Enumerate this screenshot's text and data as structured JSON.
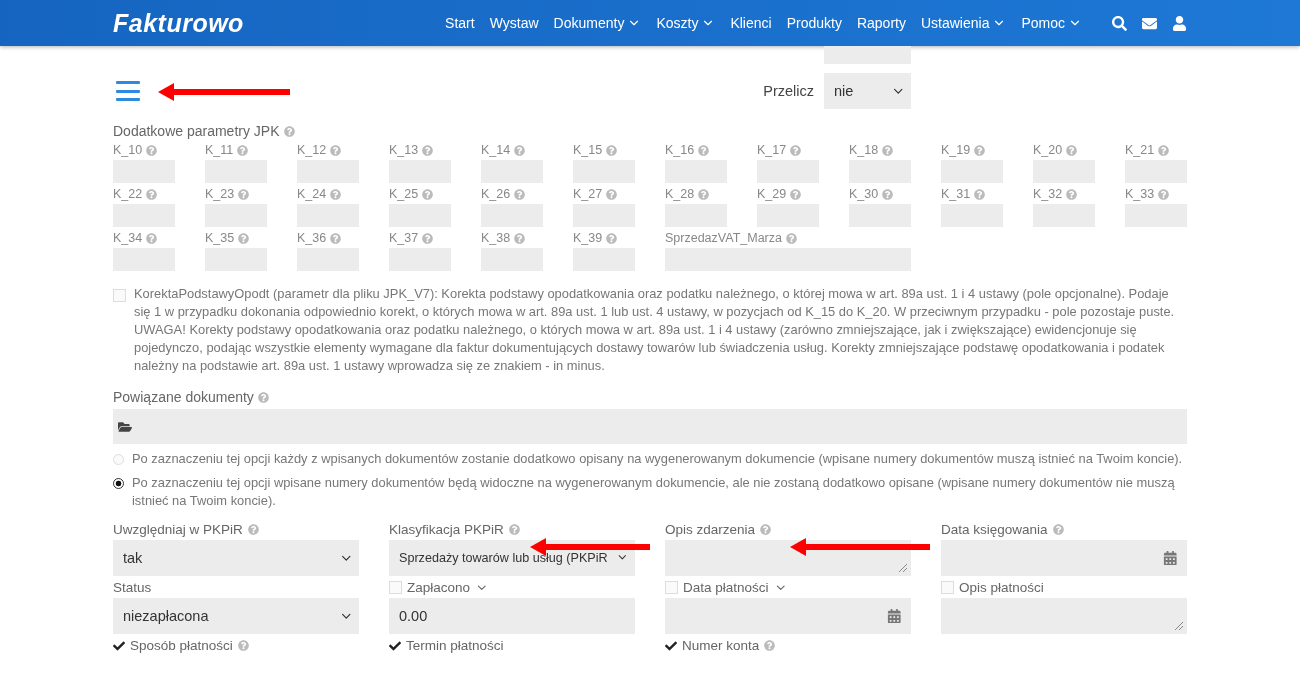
{
  "header": {
    "logo": "Fakturowo",
    "nav": [
      {
        "label": "Start",
        "dropdown": false
      },
      {
        "label": "Wystaw",
        "dropdown": false
      },
      {
        "label": "Dokumenty",
        "dropdown": true
      },
      {
        "label": "Koszty",
        "dropdown": true
      },
      {
        "label": "Klienci",
        "dropdown": false
      },
      {
        "label": "Produkty",
        "dropdown": false
      },
      {
        "label": "Raporty",
        "dropdown": false
      },
      {
        "label": "Ustawienia",
        "dropdown": true
      },
      {
        "label": "Pomoc",
        "dropdown": true
      }
    ]
  },
  "convert": {
    "label": "Przelicz",
    "value": "nie"
  },
  "jpk": {
    "label": "Dodatkowe parametry JPK",
    "fields": [
      {
        "label": "K_10",
        "kind": "narrow"
      },
      {
        "label": "K_11",
        "kind": "narrow"
      },
      {
        "label": "K_12",
        "kind": "narrow"
      },
      {
        "label": "K_13",
        "kind": "narrow"
      },
      {
        "label": "K_14",
        "kind": "narrow"
      },
      {
        "label": "K_15",
        "kind": "narrow"
      },
      {
        "label": "K_16",
        "kind": "narrow"
      },
      {
        "label": "K_17",
        "kind": "narrow"
      },
      {
        "label": "K_18",
        "kind": "narrow"
      },
      {
        "label": "K_19",
        "kind": "narrow"
      },
      {
        "label": "K_20",
        "kind": "narrow"
      },
      {
        "label": "K_21",
        "kind": "narrow"
      },
      {
        "label": "K_22",
        "kind": "narrow"
      },
      {
        "label": "K_23",
        "kind": "narrow"
      },
      {
        "label": "K_24",
        "kind": "narrow"
      },
      {
        "label": "K_25",
        "kind": "narrow"
      },
      {
        "label": "K_26",
        "kind": "narrow"
      },
      {
        "label": "K_27",
        "kind": "narrow"
      },
      {
        "label": "K_28",
        "kind": "narrow"
      },
      {
        "label": "K_29",
        "kind": "narrow"
      },
      {
        "label": "K_30",
        "kind": "narrow"
      },
      {
        "label": "K_31",
        "kind": "narrow"
      },
      {
        "label": "K_32",
        "kind": "narrow"
      },
      {
        "label": "K_33",
        "kind": "narrow"
      },
      {
        "label": "K_34",
        "kind": "narrow"
      },
      {
        "label": "K_35",
        "kind": "narrow"
      },
      {
        "label": "K_36",
        "kind": "narrow"
      },
      {
        "label": "K_37",
        "kind": "narrow"
      },
      {
        "label": "K_38",
        "kind": "narrow"
      },
      {
        "label": "K_39",
        "kind": "narrow"
      },
      {
        "label": "SprzedazVAT_Marza",
        "kind": "wide"
      }
    ]
  },
  "correction": {
    "checked": false,
    "text": "KorektaPodstawyOpodt (parametr dla pliku JPK_V7): Korekta podstawy opodatkowania oraz podatku należnego, o której mowa w art. 89a ust. 1 i 4 ustawy (pole opcjonalne). Podaje się 1 w przypadku dokonania odpowiednio korekt, o których mowa w art. 89a ust. 1 lub ust. 4 ustawy, w pozycjach od K_15 do K_20. W przeciwnym przypadku - pole pozostaje puste. UWAGA! Korekty podstawy opodatkowania oraz podatku należnego, o których mowa w art. 89a ust. 1 i 4 ustawy (zarówno zmniejszające, jak i zwiększające) ewidencjonuje się pojedynczo, podając wszystkie elementy wymagane dla faktur dokumentujących dostawy towarów lub świadczenia usług. Korekty zmniejszające podstawę opodatkowania i podatek należny na podstawie art. 89a ust. 1 ustawy wprowadza się ze znakiem - in minus."
  },
  "related": {
    "label": "Powiązane dokumenty",
    "options": [
      {
        "text": "Po zaznaczeniu tej opcji każdy z wpisanych dokumentów zostanie dodatkowo opisany na wygenerowanym dokumencie (wpisane numery dokumentów muszą istnieć na Twoim koncie).",
        "selected": false
      },
      {
        "text": "Po zaznaczeniu tej opcji wpisane numery dokumentów będą widoczne na wygenerowanym dokumencie, ale nie zostaną dodatkowo opisane (wpisane numery dokumentów nie muszą istnieć na Twoim koncie).",
        "selected": true
      }
    ]
  },
  "form": [
    {
      "label": "Uwzględniaj w PKPiR",
      "help": true,
      "chevron": false,
      "kind": "select",
      "value": "tak"
    },
    {
      "label": "Klasyfikacja PKPiR",
      "help": true,
      "chevron": false,
      "kind": "select",
      "value": "Sprzedaży towarów lub usług (PKPiR"
    },
    {
      "label": "Opis zdarzenia",
      "help": true,
      "chevron": false,
      "kind": "textarea"
    },
    {
      "label": "Data księgowania",
      "help": true,
      "chevron": false,
      "kind": "date"
    },
    {
      "label": "Status",
      "help": false,
      "chevron": false,
      "kind": "select",
      "value": "niezapłacona"
    },
    {
      "label": "Zapłacono",
      "checked": false,
      "help": false,
      "chevron": true,
      "kind": "input",
      "value": "0.00"
    },
    {
      "label": "Data płatności",
      "checked": false,
      "help": false,
      "chevron": true,
      "kind": "date"
    },
    {
      "label": "Opis płatności",
      "checked": false,
      "help": false,
      "chevron": false,
      "kind": "textarea"
    },
    {
      "label": "Sposób płatności",
      "checked": true,
      "help": true,
      "chevron": false,
      "kind": "none"
    },
    {
      "label": "Termin płatności",
      "checked": true,
      "help": false,
      "chevron": false,
      "kind": "none"
    },
    {
      "label": "Numer konta",
      "checked": true,
      "help": true,
      "chevron": false,
      "kind": "none"
    }
  ]
}
